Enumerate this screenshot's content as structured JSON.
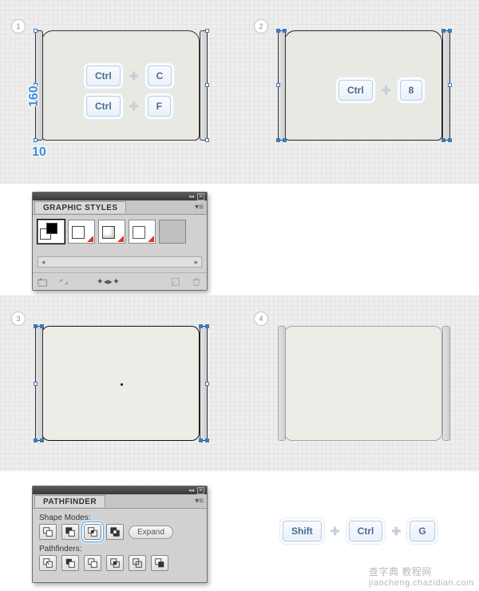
{
  "steps": {
    "s1": "1",
    "s2": "2",
    "s3": "3",
    "s4": "4"
  },
  "measurements": {
    "height": "160",
    "rail_width": "10"
  },
  "combos": {
    "copy": {
      "k1": "Ctrl",
      "k2": "C"
    },
    "paste_front": {
      "k1": "Ctrl",
      "k2": "F"
    },
    "group8": {
      "k1": "Ctrl",
      "k2": "8"
    },
    "ungroup": {
      "k1": "Shift",
      "k2": "Ctrl",
      "k3": "G"
    }
  },
  "graphic_styles": {
    "title": "GRAPHIC STYLES"
  },
  "pathfinder": {
    "title": "PATHFINDER",
    "shape_modes_label": "Shape Modes:",
    "pathfinders_label": "Pathfinders:",
    "expand_label": "Expand"
  },
  "watermark": {
    "cn": "查字典",
    "en": "教程网",
    "url": "jiaocheng.chazidian.com"
  }
}
